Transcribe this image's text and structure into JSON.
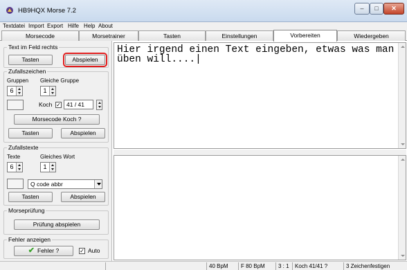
{
  "window": {
    "title": "HB9HQX Morse 7.2"
  },
  "menu": [
    "Textdatei",
    "Import",
    "Export",
    "Hilfe",
    "Help",
    "About"
  ],
  "tabs": [
    "Morsecode",
    "Morsetrainer",
    "Tasten",
    "Einstellungen",
    "Vorbereiten",
    "Wiedergeben"
  ],
  "active_tab": "Vorbereiten",
  "text_field_group": {
    "title": "Text im Feld rechts",
    "tasten": "Tasten",
    "abspielen": "Abspielen"
  },
  "zufallszeichen": {
    "title": "Zufallszeichen",
    "gruppen_label": "Gruppen",
    "gleiche_label": "Gleiche Gruppe",
    "gruppen_value": "6",
    "gleiche_value": "1",
    "koch_label": "Koch",
    "koch_checked": "✓",
    "koch_value": "41 / 41",
    "koch_button": "Morsecode Koch ?",
    "tasten": "Tasten",
    "abspielen": "Abspielen"
  },
  "zufallstexte": {
    "title": "Zufallstexte",
    "texte_label": "Texte",
    "gleiches_label": "Gleiches Wort",
    "texte_value": "6",
    "gleiches_value": "1",
    "select_value": "Q code abbr",
    "tasten": "Tasten",
    "abspielen": "Abspielen"
  },
  "morsepruefung": {
    "title": "Morseprüfung",
    "button": "Prüfung abspielen"
  },
  "fehler": {
    "title": "Fehler anzeigen",
    "button": "Fehler ?",
    "check_mark": "✓",
    "auto_label": "Auto"
  },
  "editor": {
    "text": "Hier irgend einen Text eingeben, etwas was man üben will....|"
  },
  "status": [
    "40 BpM",
    "F 80 BpM",
    "3 : 1",
    "Koch 41/41 ?",
    "3 Zeichenfestigen"
  ],
  "colors": {
    "highlight": "#e21d1d",
    "check_green": "#3aa12b"
  }
}
